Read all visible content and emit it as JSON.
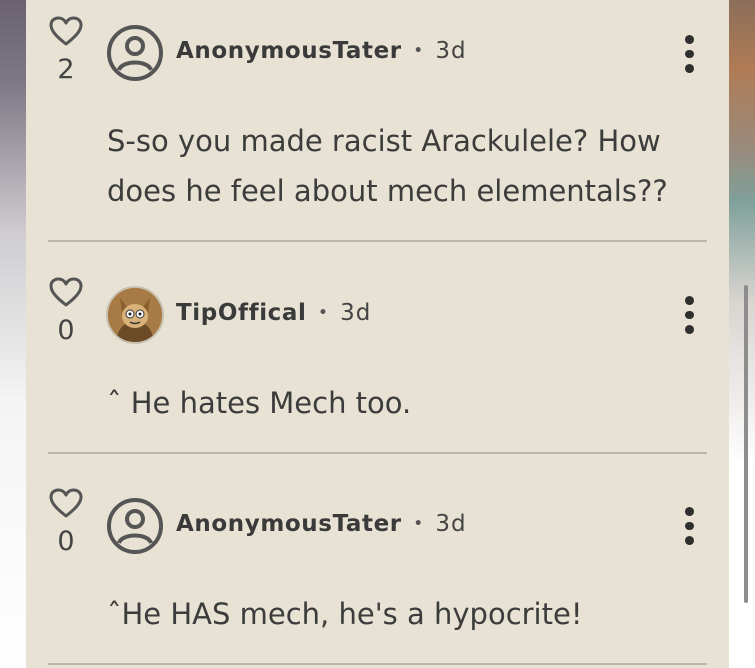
{
  "comments": [
    {
      "likes": "2",
      "author": "AnonymousTater",
      "separator": "•",
      "time": "3d",
      "text": "S-so you made racist Arackulele? How does he feel about mech elementals??",
      "avatar": "default-user-icon"
    },
    {
      "likes": "0",
      "author": "TipOffical",
      "separator": "•",
      "time": "3d",
      "text": "ˆ He hates Mech too.",
      "avatar": "user-photo"
    },
    {
      "likes": "0",
      "author": "AnonymousTater",
      "separator": "•",
      "time": "3d",
      "text": "ˆHe HAS mech, he's a hypocrite!",
      "avatar": "default-user-icon"
    }
  ],
  "colors": {
    "panel_bg": "#e8e2d4",
    "text": "#3c3c3c",
    "divider": "#bcb7ac",
    "icon": "#555555"
  }
}
